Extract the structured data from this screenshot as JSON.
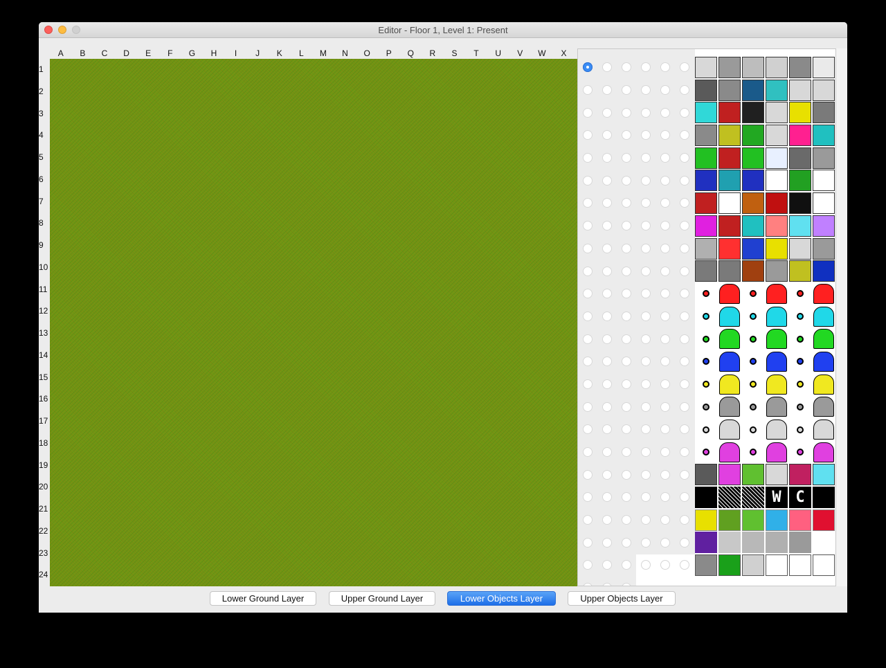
{
  "window": {
    "title": "Editor - Floor 1, Level 1: Present"
  },
  "grid": {
    "columns": [
      "A",
      "B",
      "C",
      "D",
      "E",
      "F",
      "G",
      "H",
      "I",
      "J",
      "K",
      "L",
      "M",
      "N",
      "O",
      "P",
      "Q",
      "R",
      "S",
      "T",
      "U",
      "V",
      "W",
      "X"
    ],
    "rows": [
      "1",
      "2",
      "3",
      "4",
      "5",
      "6",
      "7",
      "8",
      "9",
      "10",
      "11",
      "12",
      "13",
      "14",
      "15",
      "16",
      "17",
      "18",
      "19",
      "20",
      "21",
      "22",
      "23",
      "24"
    ]
  },
  "picker": {
    "selected_radio_index": 0,
    "radio_count": 141,
    "tile_labels": {
      "w_tile": "W",
      "c_tile": "C"
    }
  },
  "colors": {
    "map_green": "#6f9812",
    "accent_blue": "#1e6fe8"
  },
  "layers": {
    "buttons": [
      {
        "label": "Lower Ground Layer"
      },
      {
        "label": "Upper Ground Layer"
      },
      {
        "label": "Lower Objects Layer",
        "active": true
      },
      {
        "label": "Upper Objects Layer"
      }
    ]
  }
}
